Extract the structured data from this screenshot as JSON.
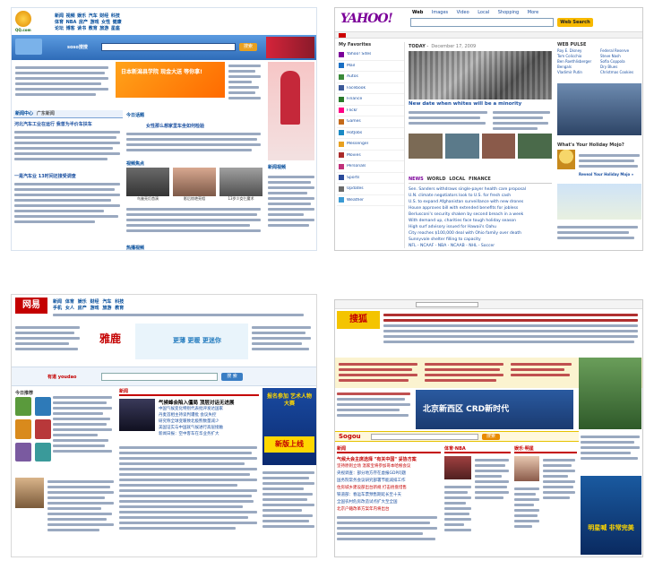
{
  "qq": {
    "logo": "QQ.com",
    "nav_rows": [
      [
        "新闻",
        "视频",
        "娱乐",
        "汽车",
        "财经",
        "科技"
      ],
      [
        "体育",
        "NBA",
        "房产",
        "游戏",
        "女性",
        "健康"
      ],
      [
        "论坛",
        "博客",
        "读书",
        "教育",
        "旅游",
        "星座"
      ]
    ],
    "search_logo": "soso搜搜",
    "search_button": "搜索",
    "banner_ad": "日本新潟县学院 现金大送 等你拿!",
    "news_tabs": [
      "新闻中心",
      "广东新闻"
    ],
    "headlines": [
      "河北汽车工业在运行 我曾为半价车扶车",
      "一是汽车业 13时间还接受调查"
    ],
    "today_heading": "今日话题",
    "today_title": "女性那么想家里车坐如何检验",
    "video_heading": "视频焦点",
    "video_captions": [
      "鸟巢亮灯首演",
      "影后惊艳亮相",
      "13岁少女仨魔术"
    ],
    "bottom_heading": "热播视频",
    "right_heading": "新闻视频"
  },
  "yahoo": {
    "top_links": [
      "Web",
      "Images",
      "Video",
      "Local",
      "Shopping",
      "More"
    ],
    "search_button": "Web Search",
    "today_label": "TODAY",
    "today_date": "December 17, 2009",
    "headline": "New date when whites will be a minority",
    "tabs": [
      "NEWS",
      "WORLD",
      "LOCAL",
      "FINANCE"
    ],
    "news_items": [
      "Sen. Sanders withdraws single-payer health care proposal",
      "U.N. climate negotiators look to U.S. for fresh cash",
      "U.S. to expand Afghanistan surveillance with new drones",
      "House approves bill with extended benefits for jobless",
      "Berlusconi's security shaken by second breach in a week",
      "With demand up, charities face tough holiday season",
      "High surf advisory issued for Hawaii's Oahu",
      "City reaches $100,000 deal with Ohio family over death",
      "Sunnyvale shelter filling to capacity",
      "NFL - NCAAF - NBA - NCAAB - NHL - Soccer"
    ],
    "sidebar_heading": "My Favorites",
    "sidebar_items": [
      "Yahoo! Sites",
      "Mail",
      "Autos",
      "Facebook",
      "Finance",
      "Flickr",
      "Games",
      "HotJobs",
      "Messenger",
      "Movies",
      "Personals",
      "Sports",
      "Updates",
      "Weather"
    ],
    "pulse_heading": "WEB PULSE",
    "pulse_items": [
      "Roy E. Disney",
      "Tom Colicchio",
      "Ben Roethlisberger",
      "Bengals",
      "Vladimir Putin",
      "Federal Reserve",
      "Steve Nash",
      "Sofia Coppola",
      "Dry Blues",
      "Christmas Cookies"
    ],
    "promo_title": "What's Your Holiday Mojo?",
    "promo_link": "Reveal Your Holiday Mojo »"
  },
  "netease": {
    "logo": "网易",
    "nav_rows": [
      [
        "新闻",
        "体育",
        "娱乐",
        "财经",
        "汽车",
        "科技"
      ],
      [
        "手机",
        "女人",
        "房产",
        "游戏",
        "旅游",
        "教育"
      ]
    ],
    "brand_ad": "雅鹿",
    "brand_tagline": "更薄 更暖 更迷你",
    "search_brand": "有道 youdao",
    "search_button": "搜 索",
    "news_heading": "新闻",
    "news_headline": "气候峰会陷入僵局 顶层对话无进展",
    "news_lines": [
      "中国气候变化特别代表批评发达国家",
      "丹麦首相主持谈判遭批 会议失控",
      "研究称全球变暖致北极熊数量减少",
      "美国证实与中国就气候进行高层接触",
      "新闻日报：空中客车在华业务扩大"
    ],
    "promo_title": "新版上线",
    "promo_subtitle": "报名参加 艺术人物大赛",
    "left_heading": "今日推荐"
  },
  "sohu": {
    "logo": "搜狐",
    "search_button": "搜索",
    "banner": "北京新西区 CRD新时代",
    "heading_news": "新闻",
    "heading_sports": "体育·NBA",
    "heading_ent": "娱乐·明星",
    "headline": "气候大会主席选择 \"有关中国\" 妥协方案",
    "news_lines": [
      "坚持原则立场 温家宝将参加哥本哈根会议",
      "央视调查：部分地方存在虚报GDP问题",
      "国务院常务会议研究部署节能减排工作",
      "住房城乡建设部出台新规 打击捂盘惜售",
      "铁道部：春运车票预售期延长至十天",
      "全国农村危房改造试点扩大至全国",
      "北京户籍改革方案年内将出台"
    ],
    "right_ad": "明星喊 非常完美"
  },
  "colors": {
    "qq_blue": "#3b79c4",
    "yahoo_purple": "#7b0099",
    "yahoo_button": "#f7b900",
    "netease_red": "#c40000",
    "sohu_yellow": "#f4c400"
  }
}
